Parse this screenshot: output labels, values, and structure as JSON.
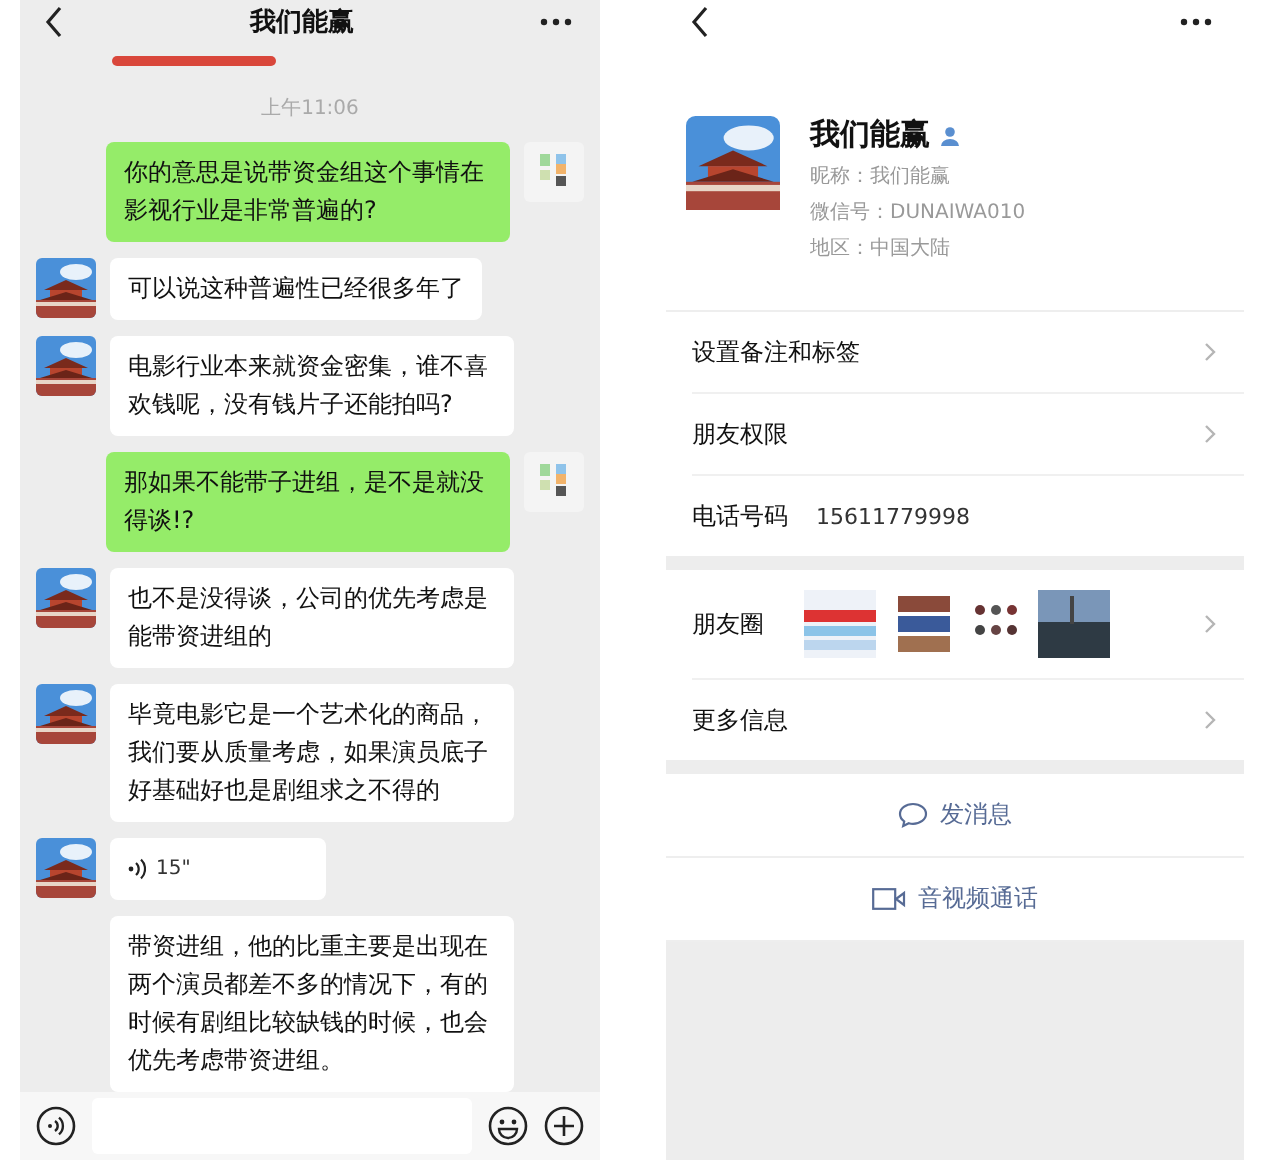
{
  "chat": {
    "title": "我们能赢",
    "time": "上午11:06",
    "messages": [
      {
        "kind": "sent",
        "show_avatar": true,
        "text": "你的意思是说带资金组这个事情在影视行业是非常普遍的?"
      },
      {
        "kind": "received",
        "show_avatar": true,
        "text": "可以说这种普遍性已经很多年了"
      },
      {
        "kind": "received",
        "show_avatar": true,
        "text": "电影行业本来就资金密集，谁不喜欢钱呢，没有钱片子还能拍吗?"
      },
      {
        "kind": "sent",
        "show_avatar": true,
        "text": "那如果不能带子进组，是不是就没得谈!?"
      },
      {
        "kind": "received",
        "show_avatar": true,
        "text": "也不是没得谈，公司的优先考虑是能带资进组的"
      },
      {
        "kind": "received",
        "show_avatar": true,
        "text": "毕竟电影它是一个艺术化的商品，我们要从质量考虑，如果演员底子好基础好也是剧组求之不得的"
      },
      {
        "kind": "voice",
        "show_avatar": true,
        "text": "15\""
      },
      {
        "kind": "received",
        "show_avatar": false,
        "text": "带资进组，他的比重主要是出现在两个演员都差不多的情况下，有的时候有剧组比较缺钱的时候，也会优先考虑带资进组。"
      }
    ]
  },
  "profile": {
    "name": "我们能赢",
    "nickname": "昵称：我们能赢",
    "wechat_id": "微信号：DUNAIWA010",
    "region": "地区：中国大陆",
    "sections": [
      [
        {
          "kind": "link",
          "label": "设置备注和标签"
        },
        {
          "kind": "link",
          "label": "朋友权限"
        },
        {
          "kind": "value",
          "label": "电话号码",
          "value": "15611779998"
        }
      ],
      [
        {
          "kind": "moments",
          "label": "朋友圈"
        },
        {
          "kind": "link",
          "label": "更多信息"
        }
      ]
    ],
    "actions": [
      {
        "kind": "message",
        "label": "发消息"
      },
      {
        "kind": "video",
        "label": "音视频通话"
      }
    ]
  }
}
